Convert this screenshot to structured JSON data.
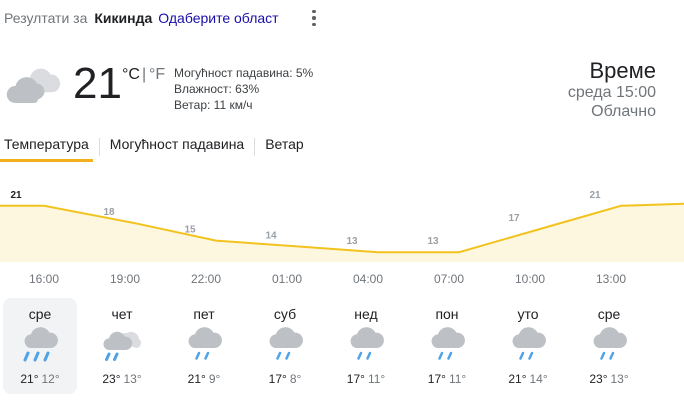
{
  "search": {
    "results_prefix": "Резултати за",
    "location": "Кикинда",
    "change_area_link": "Одаберите област"
  },
  "current": {
    "temperature": "21",
    "unit_c": "°C",
    "unit_separator": "|",
    "unit_f": "°F",
    "precipitation": "Могућност падавина: 5%",
    "humidity": "Влажност: 63%",
    "wind": "Ветар: 11 км/ч",
    "icon": "cloudy-icon"
  },
  "header": {
    "title": "Време",
    "time": "среда 15:00",
    "condition": "Облачно"
  },
  "tabs": [
    {
      "label": "Температура",
      "active": true
    },
    {
      "label": "Могућност падавина",
      "active": false
    },
    {
      "label": "Ветар",
      "active": false
    }
  ],
  "chart_data": {
    "type": "area",
    "x": [
      "16:00",
      "19:00",
      "22:00",
      "01:00",
      "04:00",
      "07:00",
      "10:00",
      "13:00"
    ],
    "values": [
      21,
      18,
      15,
      14,
      13,
      13,
      17,
      21
    ],
    "labels": [
      "21",
      "18",
      "15",
      "14",
      "13",
      "13",
      "17",
      "21"
    ],
    "color": "#f2c31e",
    "fill": "#fef7e0"
  },
  "hours": [
    "16:00",
    "19:00",
    "22:00",
    "01:00",
    "04:00",
    "07:00",
    "10:00",
    "13:00"
  ],
  "days": [
    {
      "name": "сре",
      "high": "21°",
      "low": "12°",
      "icon": "rain-icon",
      "selected": true
    },
    {
      "name": "чет",
      "high": "23°",
      "low": "13°",
      "icon": "partly-cloudy-rain-icon",
      "selected": false
    },
    {
      "name": "пет",
      "high": "21°",
      "low": "9°",
      "icon": "light-rain-icon",
      "selected": false
    },
    {
      "name": "суб",
      "high": "17°",
      "low": "8°",
      "icon": "light-rain-icon",
      "selected": false
    },
    {
      "name": "нед",
      "high": "17°",
      "low": "11°",
      "icon": "light-rain-icon",
      "selected": false
    },
    {
      "name": "пон",
      "high": "17°",
      "low": "11°",
      "icon": "light-rain-icon",
      "selected": false
    },
    {
      "name": "уто",
      "high": "21°",
      "low": "14°",
      "icon": "light-rain-icon",
      "selected": false
    },
    {
      "name": "сре",
      "high": "23°",
      "low": "13°",
      "icon": "light-rain-icon",
      "selected": false
    }
  ]
}
